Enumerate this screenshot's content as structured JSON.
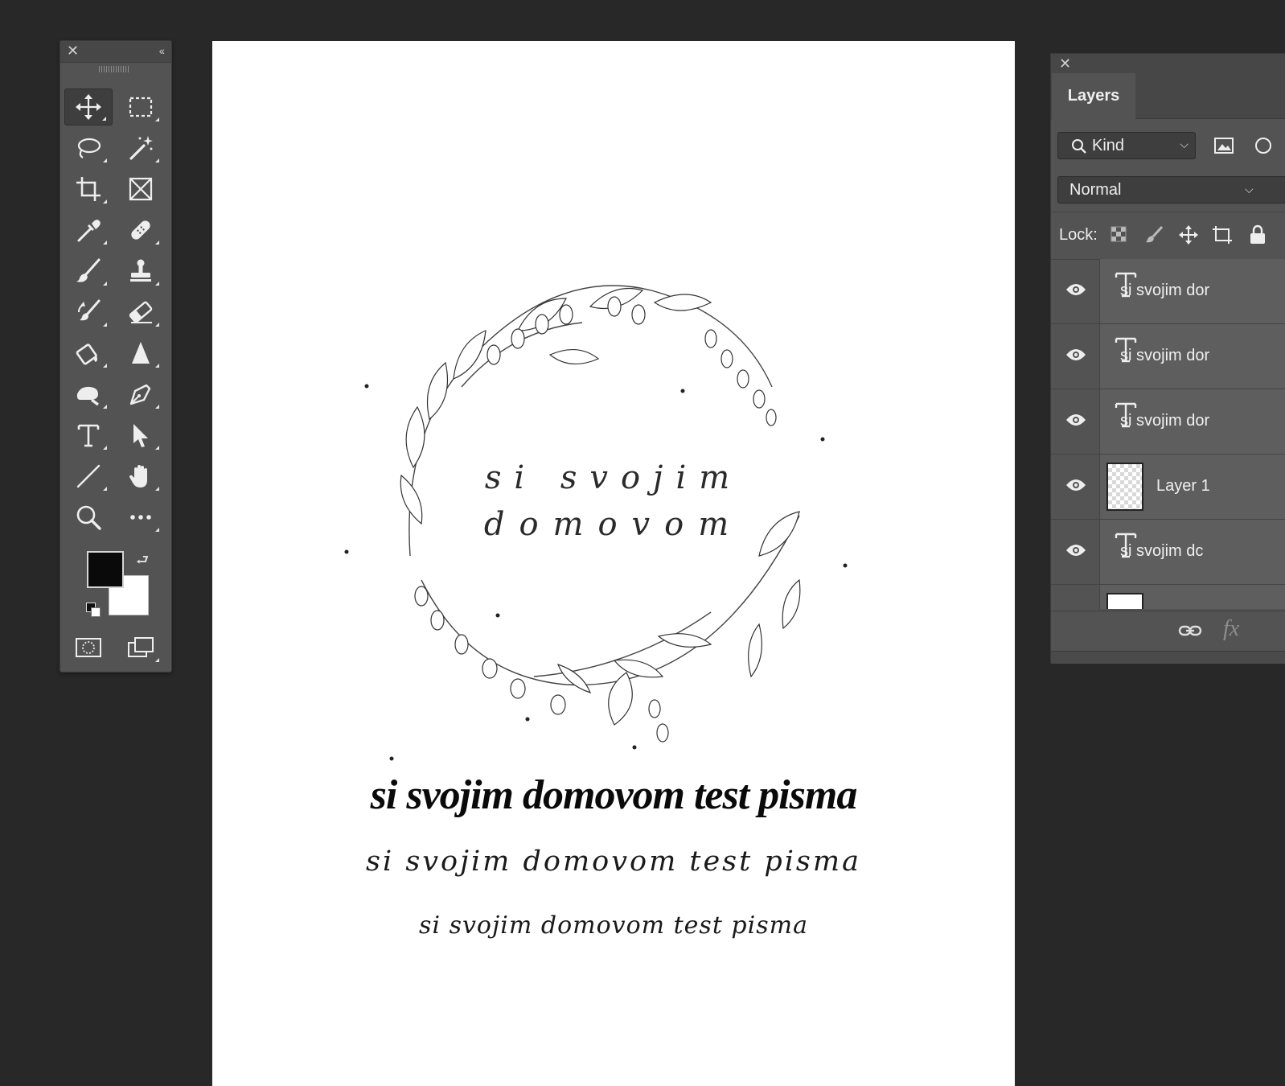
{
  "tools_panel": {
    "close_glyph": "✕",
    "collapse_glyph": "‹‹",
    "tools": [
      {
        "name": "move-tool-icon",
        "active": true
      },
      {
        "name": "marquee-tool-icon"
      },
      {
        "name": "lasso-tool-icon"
      },
      {
        "name": "magic-wand-tool-icon"
      },
      {
        "name": "crop-tool-icon"
      },
      {
        "name": "frame-tool-icon"
      },
      {
        "name": "eyedropper-tool-icon"
      },
      {
        "name": "healing-brush-tool-icon"
      },
      {
        "name": "brush-tool-icon"
      },
      {
        "name": "clone-stamp-tool-icon"
      },
      {
        "name": "history-brush-tool-icon"
      },
      {
        "name": "eraser-tool-icon"
      },
      {
        "name": "paint-bucket-tool-icon"
      },
      {
        "name": "sharpen-tool-icon"
      },
      {
        "name": "dodge-tool-icon"
      },
      {
        "name": "pen-tool-icon"
      },
      {
        "name": "type-tool-icon"
      },
      {
        "name": "path-selection-tool-icon"
      },
      {
        "name": "line-tool-icon"
      },
      {
        "name": "hand-tool-icon"
      },
      {
        "name": "zoom-tool-icon"
      },
      {
        "name": "more-tools-icon"
      }
    ],
    "foreground_color": "#0a0a0a",
    "background_color": "#ffffff"
  },
  "canvas": {
    "wreath_line1": "si svojim",
    "wreath_line2": "domovom",
    "line_bold": "si svojim domovom test pisma",
    "line_script1": "si svojim domovom test pisma",
    "line_script2": "si svojim domovom test pisma"
  },
  "layers_panel": {
    "close_glyph": "✕",
    "tab_label": "Layers",
    "kind_filter": "Kind",
    "blend_mode": "Normal",
    "lock_label": "Lock:",
    "layers": [
      {
        "name": "si svojim dor",
        "type": "text",
        "visible": true
      },
      {
        "name": "si svojim dor",
        "type": "text",
        "visible": true
      },
      {
        "name": "si svojim dor",
        "type": "text",
        "visible": true
      },
      {
        "name": "Layer 1",
        "type": "raster",
        "visible": true
      },
      {
        "name": "si svojim   dc",
        "type": "text",
        "visible": true
      }
    ],
    "footer_fx": "fx"
  }
}
